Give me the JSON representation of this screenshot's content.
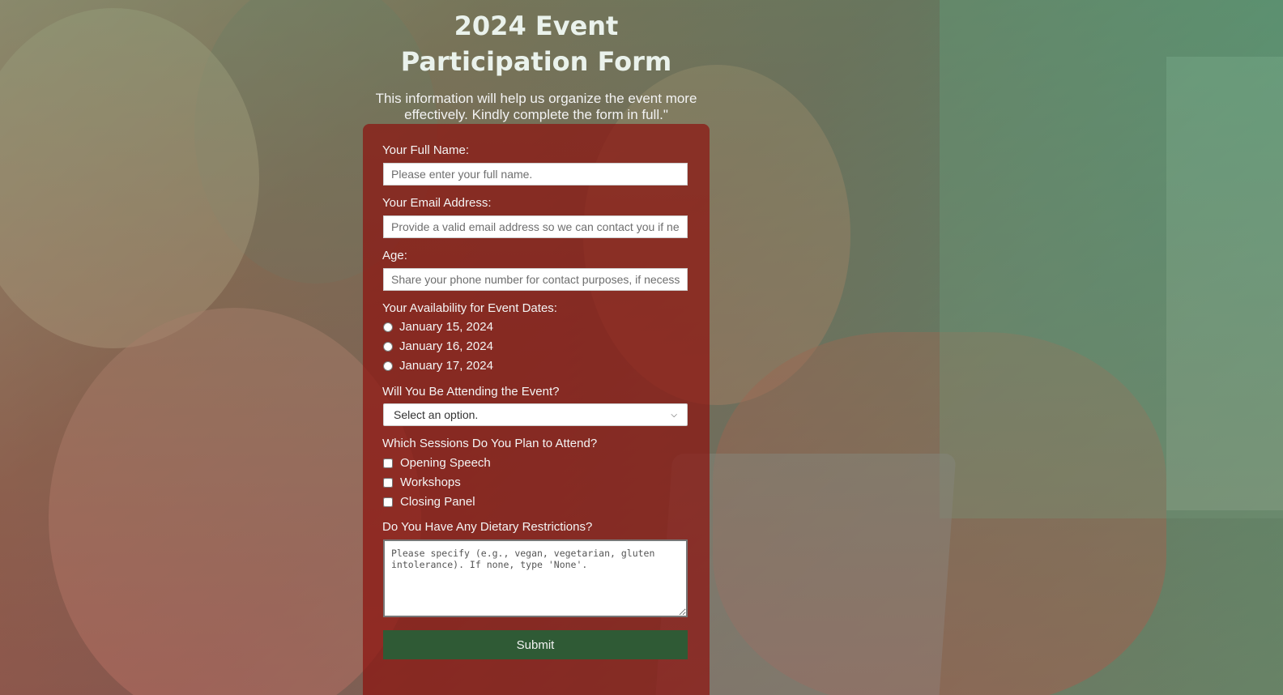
{
  "page": {
    "title": "2024 Event Participation Form",
    "intro": "This information will help us organize the event more effectively. Kindly complete the form in full.\""
  },
  "form": {
    "full_name": {
      "label": "Your Full Name:",
      "placeholder": "Please enter your full name."
    },
    "email": {
      "label": "Your Email Address:",
      "placeholder": "Provide a valid email address so we can contact you if needed."
    },
    "age": {
      "label": "Age:",
      "placeholder": "Share your phone number for contact purposes, if necessary."
    },
    "availability": {
      "label": "Your Availability for Event Dates:",
      "options": [
        "January 15, 2024",
        "January 16, 2024",
        "January 17, 2024"
      ]
    },
    "attending": {
      "label": "Will You Be Attending the Event?",
      "selected": "Select an option."
    },
    "sessions": {
      "label": "Which Sessions Do You Plan to Attend?",
      "options": [
        "Opening Speech",
        "Workshops",
        "Closing Panel"
      ]
    },
    "dietary": {
      "label": "Do You Have Any Dietary Restrictions?",
      "placeholder": "Please specify (e.g., vegan, vegetarian, gluten intolerance). If none, type 'None'."
    },
    "submit_label": "Submit"
  },
  "colors": {
    "form_background": "#8c140f",
    "submit_button": "#2f5a35",
    "background_green": "#5fae85"
  },
  "icons": {
    "select_chevron": "chevron-down-icon"
  }
}
